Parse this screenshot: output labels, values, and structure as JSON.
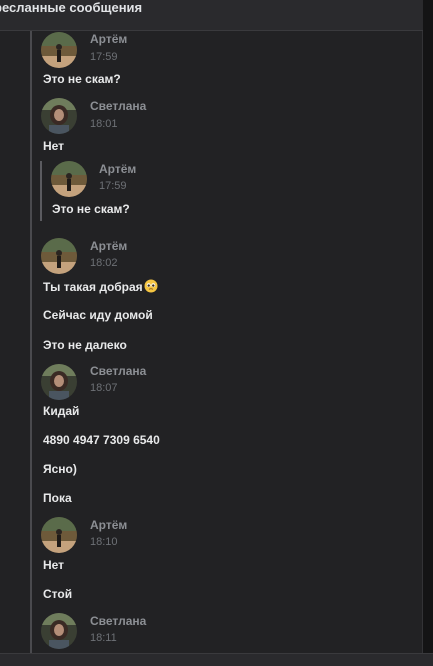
{
  "header": {
    "title": "ресланные сообщения"
  },
  "messages": [
    {
      "author": "Артём",
      "time": "17:59",
      "lines": [
        "Это не скам?"
      ]
    },
    {
      "author": "Светлана",
      "time": "18:01",
      "lines": [
        "Нет"
      ],
      "forwarded": {
        "author": "Артём",
        "time": "17:59",
        "text": "Это не скам?"
      }
    },
    {
      "author": "Артём",
      "time": "18:02",
      "lines": [
        "Ты такая добрая",
        "Сейчас иду домой",
        "Это не далеко"
      ],
      "emoji": "pleading-face-icon"
    },
    {
      "author": "Светлана",
      "time": "18:07",
      "lines": [
        "Кидай",
        "4890 4947 7309 6540",
        "Ясно)",
        "Пока"
      ]
    },
    {
      "author": "Артём",
      "time": "18:10",
      "lines": [
        "Нет",
        "Стой"
      ]
    },
    {
      "author": "Светлана",
      "time": "18:11",
      "lines": []
    }
  ],
  "colors": {
    "background": "#222224",
    "accent_line": "#4a4a4e",
    "author": "#8c8f94",
    "time": "#6e7176"
  }
}
